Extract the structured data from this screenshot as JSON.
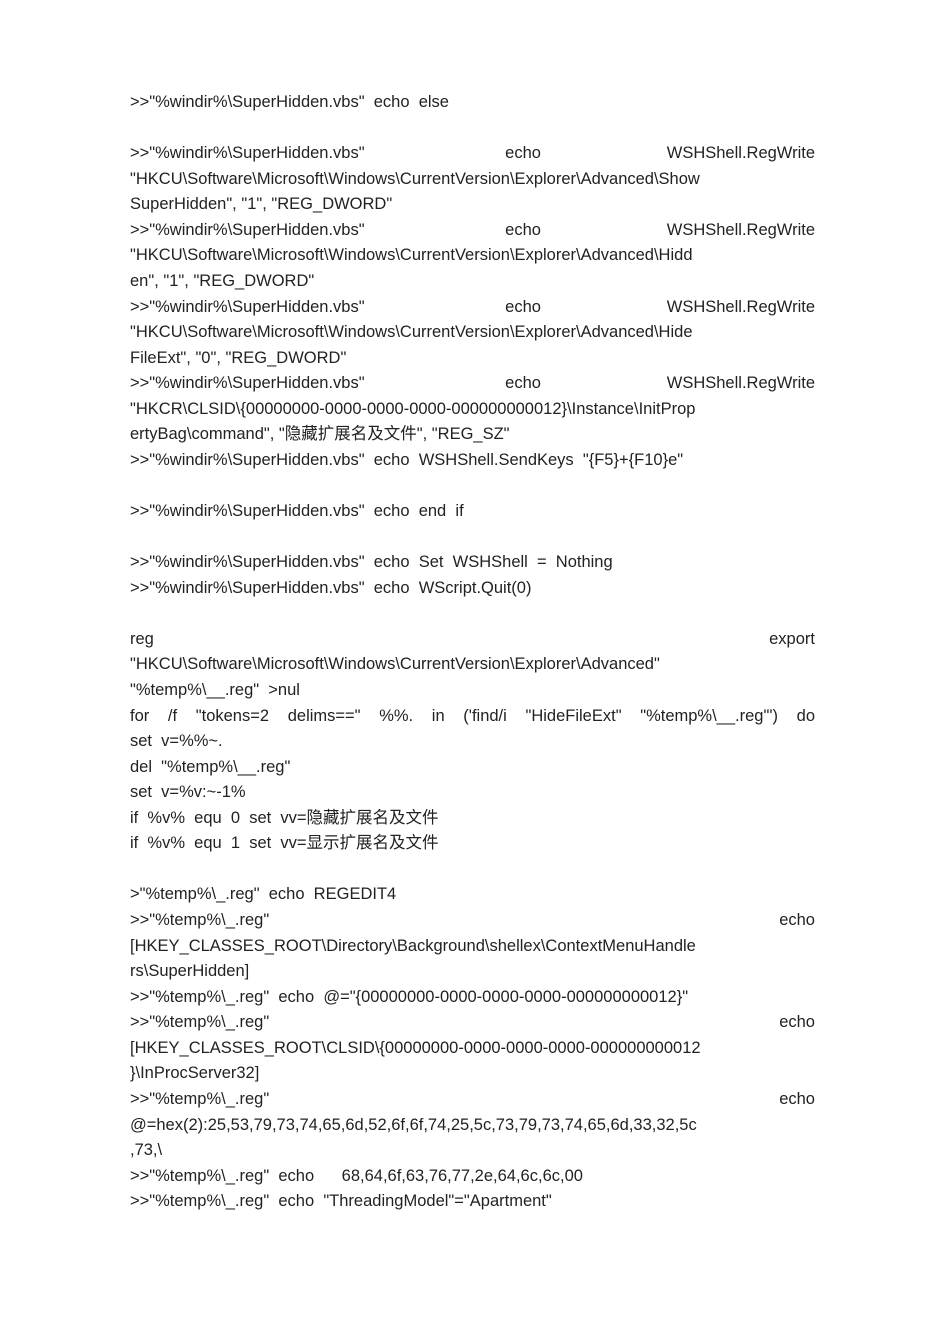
{
  "lines": [
    {
      "text": ">>\"%windir%\\SuperHidden.vbs\"  echo  else",
      "justify": false,
      "gap_after": true
    },
    {
      "text": ">>\"%windir%\\SuperHidden.vbs\"                   echo                 WSHShell.RegWrite",
      "justify": true
    },
    {
      "text": "\"HKCU\\Software\\Microsoft\\Windows\\CurrentVersion\\Explorer\\Advanced\\Show",
      "justify": true
    },
    {
      "text": "SuperHidden\", \"1\", \"REG_DWORD\"",
      "justify": false
    },
    {
      "text": ">>\"%windir%\\SuperHidden.vbs\"                   echo                 WSHShell.RegWrite",
      "justify": true
    },
    {
      "text": "\"HKCU\\Software\\Microsoft\\Windows\\CurrentVersion\\Explorer\\Advanced\\Hidd",
      "justify": true
    },
    {
      "text": "en\", \"1\", \"REG_DWORD\"",
      "justify": false
    },
    {
      "text": ">>\"%windir%\\SuperHidden.vbs\"                   echo                 WSHShell.RegWrite",
      "justify": true
    },
    {
      "text": "\"HKCU\\Software\\Microsoft\\Windows\\CurrentVersion\\Explorer\\Advanced\\Hide",
      "justify": true
    },
    {
      "text": "FileExt\", \"0\", \"REG_DWORD\"",
      "justify": false
    },
    {
      "text": ">>\"%windir%\\SuperHidden.vbs\"                   echo                 WSHShell.RegWrite",
      "justify": true
    },
    {
      "text": "\"HKCR\\CLSID\\{00000000-0000-0000-0000-000000000012}\\Instance\\InitProp",
      "justify": true
    },
    {
      "text": "ertyBag\\command\", \"隐藏扩展名及文件\", \"REG_SZ\"",
      "justify": false
    },
    {
      "text": ">>\"%windir%\\SuperHidden.vbs\"  echo  WSHShell.SendKeys  \"{F5}+{F10}e\"",
      "justify": false,
      "gap_after": true
    },
    {
      "text": ">>\"%windir%\\SuperHidden.vbs\"  echo  end  if",
      "justify": false,
      "gap_after": true
    },
    {
      "text": ">>\"%windir%\\SuperHidden.vbs\"  echo  Set  WSHShell  =  Nothing",
      "justify": false
    },
    {
      "text": ">>\"%windir%\\SuperHidden.vbs\"  echo  WScript.Quit(0)",
      "justify": false,
      "gap_after": true
    },
    {
      "text": "reg                                                                                                    export",
      "justify": true
    },
    {
      "text": "\"HKCU\\Software\\Microsoft\\Windows\\CurrentVersion\\Explorer\\Advanced\"",
      "justify": true
    },
    {
      "text": "\"%temp%\\__.reg\"  >nul",
      "justify": false
    },
    {
      "text": "for  /f  \"tokens=2  delims==\"  %%.  in  ('find/i  \"HideFileExt\"  \"%temp%\\__.reg\"')  do",
      "justify": true
    },
    {
      "text": "set  v=%%~.",
      "justify": false
    },
    {
      "text": "del  \"%temp%\\__.reg\"",
      "justify": false
    },
    {
      "text": "set  v=%v:~-1%",
      "justify": false
    },
    {
      "text": "if  %v%  equ  0  set  vv=隐藏扩展名及文件",
      "justify": false
    },
    {
      "text": "if  %v%  equ  1  set  vv=显示扩展名及文件",
      "justify": false,
      "gap_after": true
    },
    {
      "text": ">\"%temp%\\_.reg\"  echo  REGEDIT4",
      "justify": false
    },
    {
      "text": ">>\"%temp%\\_.reg\"                                                                                   echo",
      "justify": true
    },
    {
      "text": "[HKEY_CLASSES_ROOT\\Directory\\Background\\shellex\\ContextMenuHandle",
      "justify": true
    },
    {
      "text": "rs\\SuperHidden]",
      "justify": false
    },
    {
      "text": ">>\"%temp%\\_.reg\"  echo  @=\"{00000000-0000-0000-0000-000000000012}\"",
      "justify": false
    },
    {
      "text": ">>\"%temp%\\_.reg\"                                                                                   echo",
      "justify": true
    },
    {
      "text": "[HKEY_CLASSES_ROOT\\CLSID\\{00000000-0000-0000-0000-000000000012",
      "justify": true
    },
    {
      "text": "}\\InProcServer32]",
      "justify": false
    },
    {
      "text": ">>\"%temp%\\_.reg\"                                                                                   echo",
      "justify": true
    },
    {
      "text": "@=hex(2):25,53,79,73,74,65,6d,52,6f,6f,74,25,5c,73,79,73,74,65,6d,33,32,5c",
      "justify": true
    },
    {
      "text": ",73,\\",
      "justify": false
    },
    {
      "text": ">>\"%temp%\\_.reg\"  echo      68,64,6f,63,76,77,2e,64,6c,6c,00",
      "justify": false
    },
    {
      "text": ">>\"%temp%\\_.reg\"  echo  \"ThreadingModel\"=\"Apartment\"",
      "justify": false
    }
  ]
}
